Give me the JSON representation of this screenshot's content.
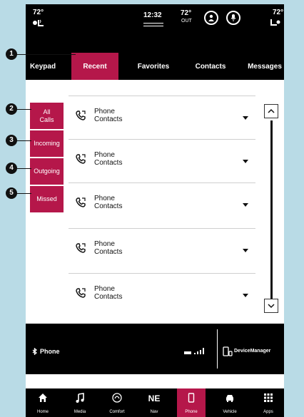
{
  "status": {
    "left_temp": "72°",
    "clock": "12:32",
    "outside_temp": "72°",
    "outside_label": "OUT",
    "right_temp": "72°"
  },
  "tabs": [
    {
      "label": "Keypad"
    },
    {
      "label": "Recent",
      "active": true
    },
    {
      "label": "Favorites"
    },
    {
      "label": "Contacts"
    },
    {
      "label": "Messages"
    }
  ],
  "filters": [
    {
      "label": "All\nCalls"
    },
    {
      "label": "Incoming"
    },
    {
      "label": "Outgoing"
    },
    {
      "label": "Missed"
    }
  ],
  "recents": [
    {
      "line1": "Phone",
      "line2": "Contacts"
    },
    {
      "line1": "Phone",
      "line2": "Contacts"
    },
    {
      "line1": "Phone",
      "line2": "Contacts"
    },
    {
      "line1": "Phone",
      "line2": "Contacts"
    },
    {
      "line1": "Phone",
      "line2": "Contacts"
    }
  ],
  "phonebar": {
    "phone_label": "Phone",
    "device_manager_label": "DeviceManager"
  },
  "nav": [
    {
      "label": "Home",
      "icon": "home-icon"
    },
    {
      "label": "Media",
      "icon": "music-note-icon"
    },
    {
      "label": "Comfort",
      "icon": "seat-icon"
    },
    {
      "label": "Nav",
      "icon": "compass-icon",
      "glyph": "NE"
    },
    {
      "label": "Phone",
      "icon": "phone-icon",
      "active": true
    },
    {
      "label": "Vehicle",
      "icon": "car-icon"
    },
    {
      "label": "Apps",
      "icon": "grid-icon"
    }
  ],
  "callouts": [
    "1",
    "2",
    "3",
    "4",
    "5"
  ],
  "colors": {
    "accent": "#b5174a",
    "background": "#b9dbe6"
  }
}
